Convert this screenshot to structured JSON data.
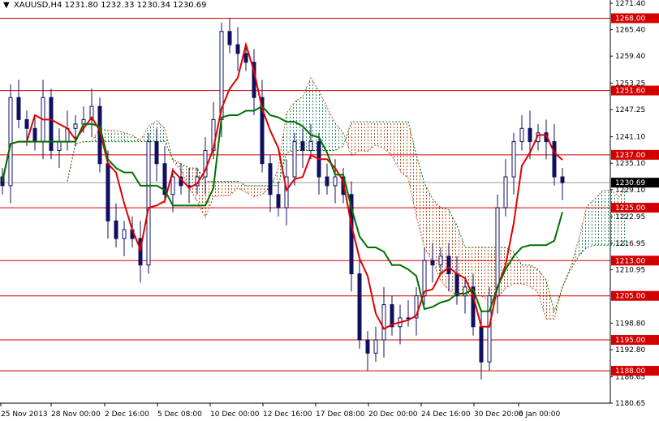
{
  "header": {
    "symbol": "XAUUSD,H4",
    "open": "1231.80",
    "high": "1232.33",
    "low": "1230.34",
    "close": "1230.69"
  },
  "colors": {
    "level_line": "#d40000",
    "tenkan": "#e00000",
    "kijun": "#007000",
    "candle": "#101060",
    "cloud_bear": "#c05020",
    "cloud_bull": "#2a8a6a",
    "current": "#000000"
  },
  "chart_data": {
    "type": "candlestick",
    "title": "XAUUSD,H4",
    "ylim": [
      1180.65,
      1271.4
    ],
    "y_ticks": [
      "1271.40",
      "1265.40",
      "1259.40",
      "1253.25",
      "1247.25",
      "1241.10",
      "1235.10",
      "1229.10",
      "1222.95",
      "1216.95",
      "1210.95",
      "1198.80",
      "1192.80",
      "1186.65",
      "1180.65"
    ],
    "x_ticks": [
      "25 Nov 2013",
      "28 Nov 00:00",
      "2 Dec 16:00",
      "5 Dec 08:00",
      "10 Dec 00:00",
      "12 Dec 16:00",
      "17 Dec 08:00",
      "20 Dec 00:00",
      "24 Dec 16:00",
      "30 Dec 20:00",
      "6 Jan 00:00"
    ],
    "levels": [
      "1268.00",
      "1251.60",
      "1237.00",
      "1225.00",
      "1213.00",
      "1205.00",
      "1195.00",
      "1188.00"
    ],
    "current_price": "1230.69",
    "closes": [
      1230,
      1250,
      1245,
      1243,
      1240,
      1250,
      1238,
      1240,
      1243,
      1244,
      1245,
      1248,
      1235,
      1222,
      1218,
      1220,
      1218,
      1212,
      1240,
      1235,
      1228,
      1232,
      1230,
      1230,
      1232,
      1238,
      1245,
      1265,
      1262,
      1260,
      1258,
      1250,
      1235,
      1228,
      1225,
      1232,
      1240,
      1238,
      1240,
      1232,
      1230,
      1232,
      1228,
      1210,
      1195,
      1192,
      1195,
      1203,
      1198,
      1200,
      1200,
      1205,
      1213,
      1212,
      1214,
      1210,
      1205,
      1207,
      1198,
      1190,
      1205,
      1225,
      1232,
      1240,
      1243,
      1240,
      1242,
      1240,
      1232,
      1230.69
    ]
  }
}
